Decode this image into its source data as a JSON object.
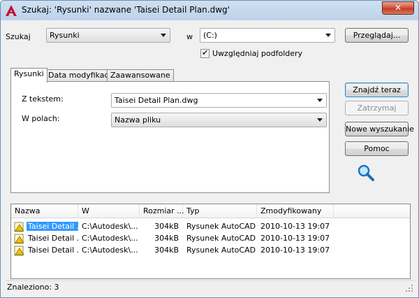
{
  "window": {
    "title": "Szukaj: 'Rysunki' nazwane 'Taisei Detail Plan.dwg'",
    "close_label": "✕"
  },
  "search": {
    "scope_label": "Szukaj",
    "scope_value": "Rysunki",
    "location_label": "w",
    "location_value": "(C:)",
    "browse_label": "Przeglądaj...",
    "subfolders_label": "Uwzględniaj podfoldery",
    "subfolders_checked": true
  },
  "tabs": [
    {
      "label": "Rysunki",
      "active": true
    },
    {
      "label": "Data modyfikacji",
      "active": false
    },
    {
      "label": "Zaawansowane",
      "active": false
    }
  ],
  "criteria": {
    "text_label": "Z tekstem:",
    "text_value": "Taisei Detail Plan.dwg",
    "fields_label": "W polach:",
    "fields_value": "Nazwa pliku"
  },
  "actions": {
    "find_now": "Znajdź teraz",
    "stop": "Zatrzymaj",
    "new_search": "Nowe wyszukanie",
    "help": "Pomoc"
  },
  "results": {
    "columns": [
      "Nazwa",
      "W",
      "Rozmiar ...",
      "Typ",
      "Zmodyfikowany"
    ],
    "rows": [
      {
        "name": "Taisei Detail ...",
        "folder": "C:\\Autodesk\\...",
        "size": "304kB",
        "type": "Rysunek AutoCAD",
        "modified": "2010-10-13 19:07"
      },
      {
        "name": "Taisei Detail ...",
        "folder": "C:\\Autodesk\\...",
        "size": "304kB",
        "type": "Rysunek AutoCAD",
        "modified": "2010-10-13 19:07"
      },
      {
        "name": "Taisei Detail ...",
        "folder": "C:\\Autodesk\\...",
        "size": "304kB",
        "type": "Rysunek AutoCAD",
        "modified": "2010-10-13 19:07"
      }
    ]
  },
  "status": {
    "found": "Znaleziono: 3"
  },
  "colors": {
    "selection": "#3399ff",
    "app_icon": "#c8102e"
  }
}
